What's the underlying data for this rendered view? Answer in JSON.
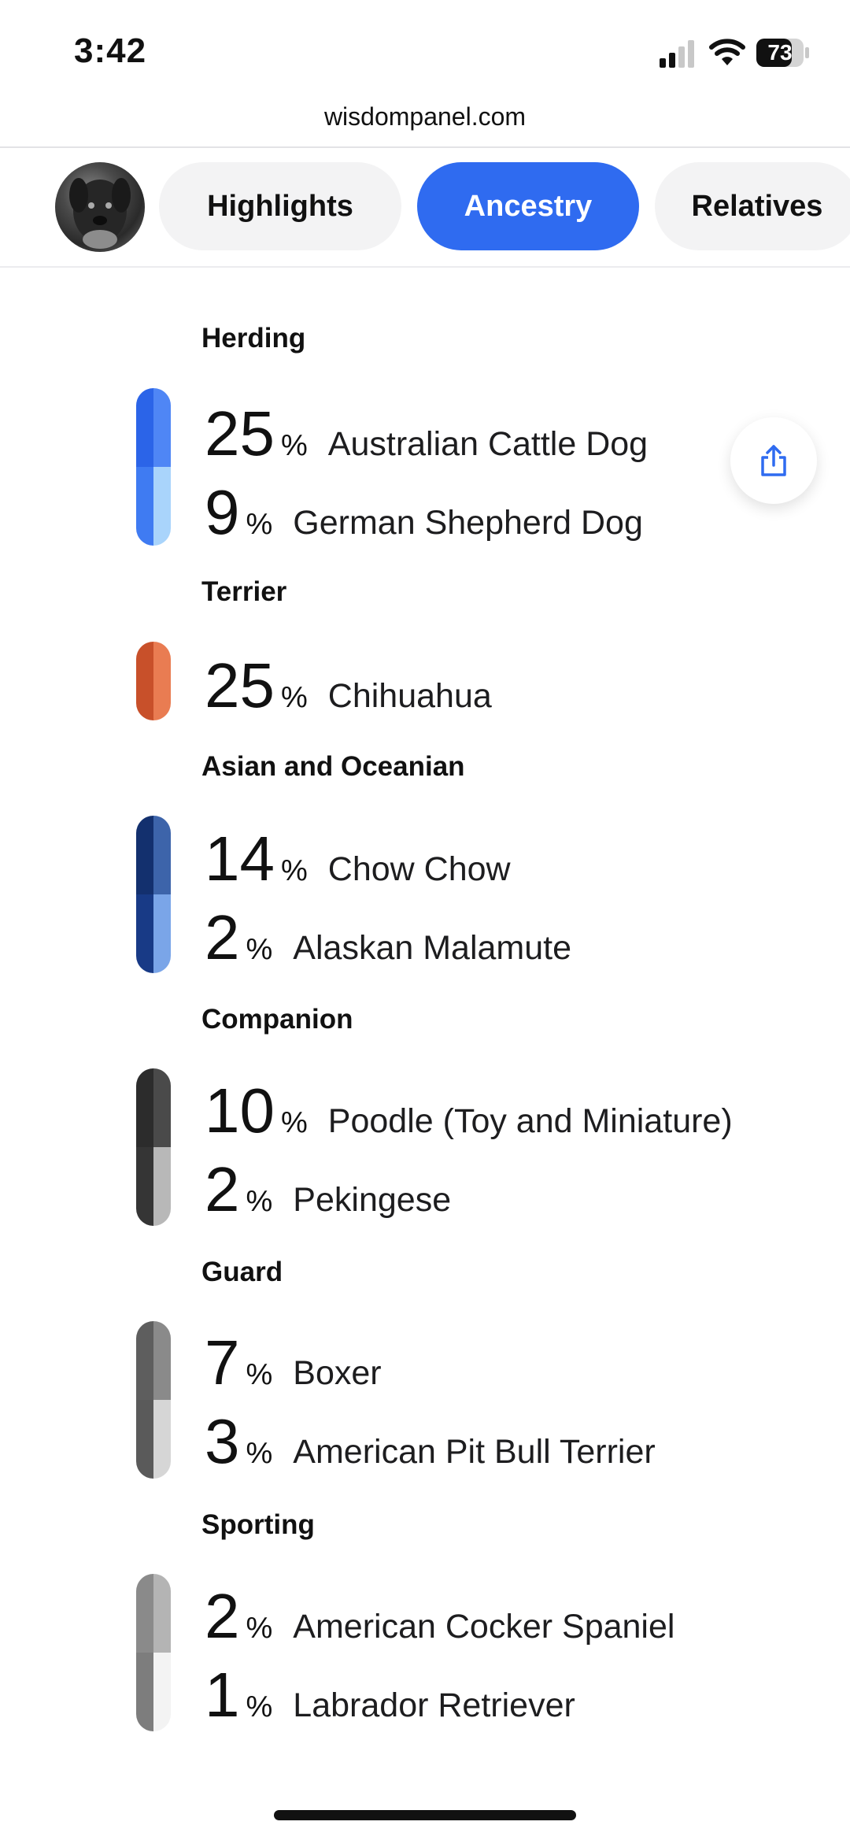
{
  "status_bar": {
    "time": "3:42",
    "battery": "73"
  },
  "url_bar": {
    "domain": "wisdompanel.com"
  },
  "tabs": [
    {
      "label": "Highlights",
      "selected": false
    },
    {
      "label": "Ancestry",
      "selected": true
    },
    {
      "label": "Relatives",
      "selected": false
    }
  ],
  "colors": {
    "accent": "#2f6bf0"
  },
  "groups": [
    {
      "title": "Herding",
      "breeds": [
        {
          "pct": "25",
          "sign": "%",
          "name": "Australian Cattle Dog"
        },
        {
          "pct": "9",
          "sign": "%",
          "name": "German Shepherd Dog"
        }
      ]
    },
    {
      "title": "Terrier",
      "breeds": [
        {
          "pct": "25",
          "sign": "%",
          "name": "Chihuahua"
        }
      ]
    },
    {
      "title": "Asian and Oceanian",
      "breeds": [
        {
          "pct": "14",
          "sign": "%",
          "name": "Chow Chow"
        },
        {
          "pct": "2",
          "sign": "%",
          "name": "Alaskan Malamute"
        }
      ]
    },
    {
      "title": "Companion",
      "breeds": [
        {
          "pct": "10",
          "sign": "%",
          "name": "Poodle (Toy and Miniature)"
        },
        {
          "pct": "2",
          "sign": "%",
          "name": "Pekingese"
        }
      ]
    },
    {
      "title": "Guard",
      "breeds": [
        {
          "pct": "7",
          "sign": "%",
          "name": "Boxer"
        },
        {
          "pct": "3",
          "sign": "%",
          "name": "American Pit Bull Terrier"
        }
      ]
    },
    {
      "title": "Sporting",
      "breeds": [
        {
          "pct": "2",
          "sign": "%",
          "name": "American Cocker Spaniel"
        },
        {
          "pct": "1",
          "sign": "%",
          "name": "Labrador Retriever"
        }
      ]
    }
  ]
}
